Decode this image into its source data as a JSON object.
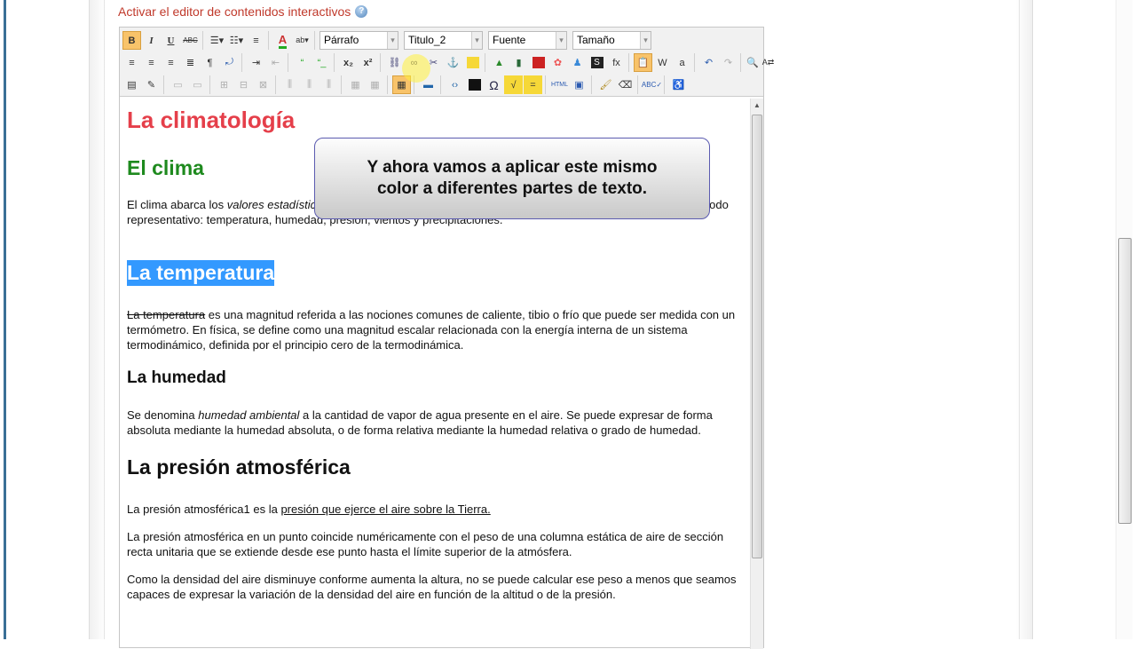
{
  "activate_label": "Activar el editor de contenidos interactivos",
  "help_icon": "?",
  "toolbar": {
    "row1": {
      "bold": "B",
      "italic": "I",
      "underline": "U",
      "strike": "ABC",
      "format": "Párrafo",
      "style": "Titulo_2",
      "font": "Fuente",
      "size": "Tamaño"
    },
    "row2": {
      "subscript": "x₂",
      "superscript": "x²"
    }
  },
  "content": {
    "title": "La climatología",
    "h_clima": "El clima",
    "p_clima_a": "El clima abarca los ",
    "p_clima_em": "valores estadísticos",
    "p_clima_b": " sobre los elementos del tiempo atmosférico en una región durante un período representativo: temperatura, humedad, presión, vientos y precipitaciones.",
    "h_temp": "La temperatura",
    "p_temp_strike": "La temperatura",
    "p_temp": " es una magnitud referida a las nociones comunes de caliente, tibio o frío que puede ser medida con un termómetro. En física, se define como una magnitud escalar relacionada con la energía interna de un sistema termodinámico, definida por el principio cero de la termodinámica.",
    "h_hum": "La humedad",
    "p_hum_a": "Se denomina ",
    "p_hum_em": "humedad ambiental",
    "p_hum_b": " a la cantidad de vapor de agua presente en el aire. Se puede expresar de forma absoluta mediante la humedad absoluta, o de forma relativa mediante la humedad relativa o grado de humedad.",
    "h_pres": "La presión atmosférica",
    "p_pres1_a": "La presión atmosférica1 es la ",
    "p_pres1_link": "presión que ejerce el aire sobre la Tierra.",
    "p_pres2": "La presión atmosférica en un punto coincide numéricamente con el peso de una columna estática de aire de sección recta unitaria que se extiende desde ese punto hasta el límite superior de la atmósfera.",
    "p_pres3": "Como la densidad del aire disminuye conforme aumenta la altura, no se puede calcular ese peso a menos que seamos capaces de expresar la variación de la densidad del aire en función de la altitud o de la presión."
  },
  "callout": "Y ahora vamos a aplicar este mismo color a diferentes partes de texto.",
  "colors": {
    "title": "#e53f4a",
    "green": "#1e8a1e",
    "selection": "#3399ff",
    "activate": "#c0392b"
  }
}
